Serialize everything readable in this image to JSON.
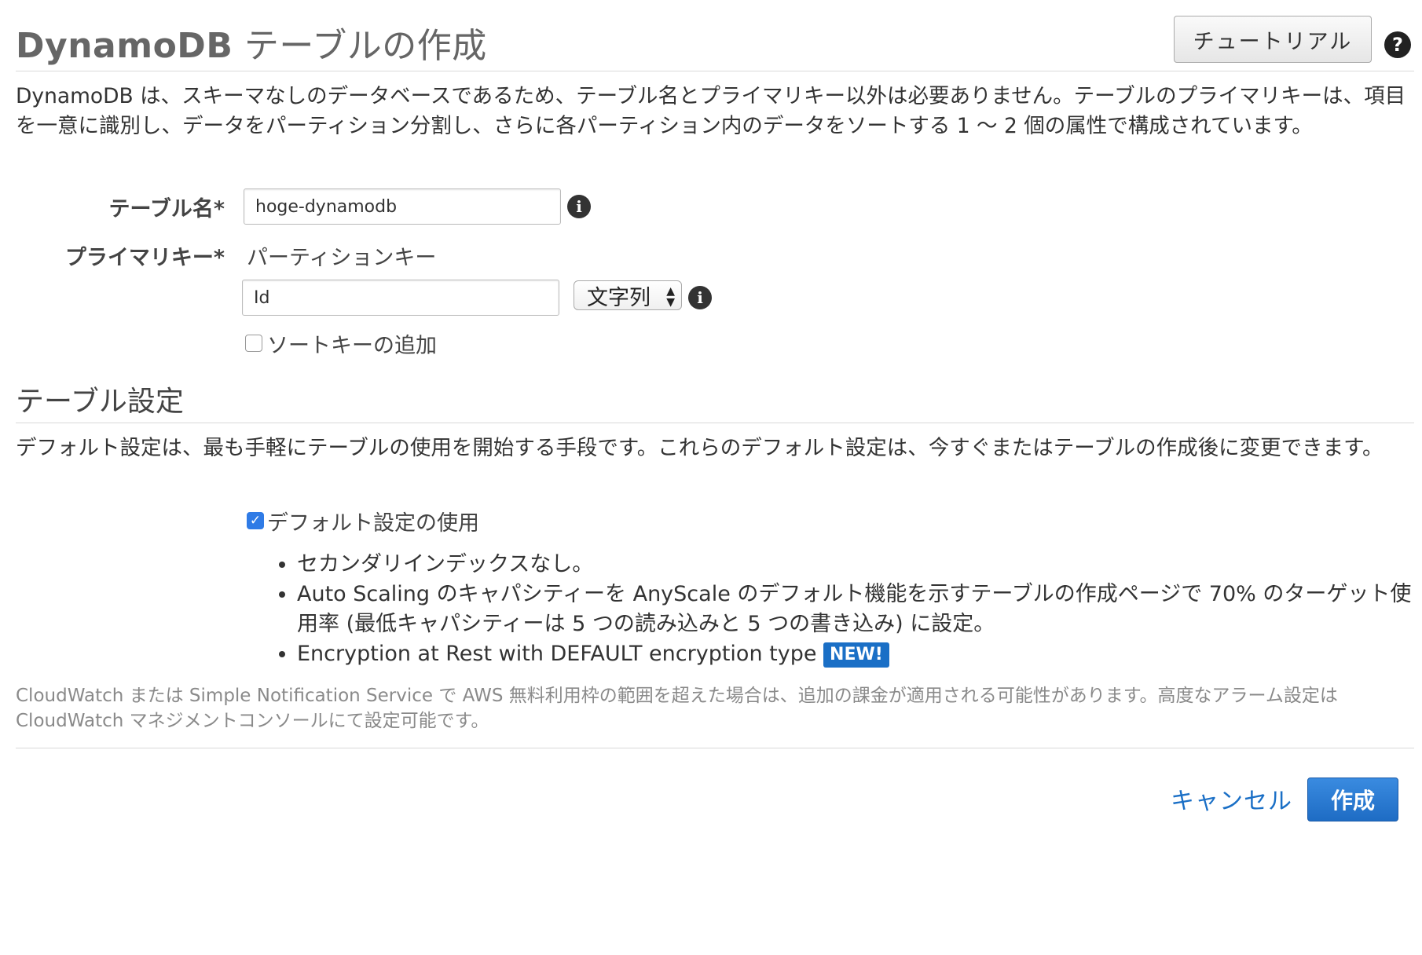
{
  "header": {
    "title_brand": "DynamoDB",
    "title_rest": " テーブルの作成",
    "tutorial_label": "チュートリアル",
    "help_glyph": "?"
  },
  "intro": {
    "text": "DynamoDB は、スキーマなしのデータベースであるため、テーブル名とプライマリキー以外は必要ありません。テーブルのプライマリキーは、項目を一意に識別し、データをパーティション分割し、さらに各パーティション内のデータをソートする 1 〜 2 個の属性で構成されています。"
  },
  "form": {
    "table_name_label": "テーブル名*",
    "table_name_value": "hoge-dynamodb",
    "primary_key_label": "プライマリキー*",
    "partition_key_label": "パーティションキー",
    "partition_key_value": "Id",
    "key_type_selected": "文字列",
    "add_sort_key_label": "ソートキーの追加",
    "info_glyph": "i"
  },
  "settings": {
    "title": "テーブル設定",
    "description": "デフォルト設定は、最も手軽にテーブルの使用を開始する手段です。これらのデフォルト設定は、今すぐまたはテーブルの作成後に変更できます。",
    "use_default_label": "デフォルト設定の使用",
    "use_default_checked": true,
    "bullets": [
      "セカンダリインデックスなし。",
      "Auto Scaling のキャパシティーを AnyScale のデフォルト機能を示すテーブルの作成ページで 70% のターゲット使用率 (最低キャパシティーは 5 つの読み込みと 5 つの書き込み) に設定。",
      "Encryption at Rest with DEFAULT encryption type"
    ],
    "new_badge": "NEW!",
    "note": "CloudWatch または Simple Notification Service で AWS 無料利用枠の範囲を超えた場合は、追加の課金が適用される可能性があります。高度なアラーム設定は CloudWatch マネジメントコンソールにて設定可能です。"
  },
  "footer": {
    "cancel_label": "キャンセル",
    "create_label": "作成"
  },
  "colors": {
    "accent": "#1a6fc6",
    "checkbox_checked": "#2f7be6"
  }
}
